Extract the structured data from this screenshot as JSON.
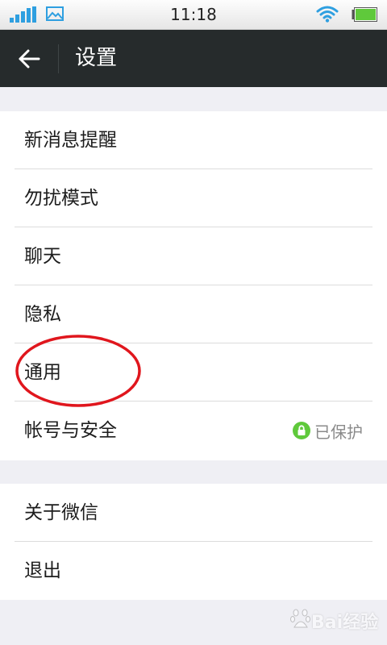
{
  "status_bar": {
    "time": "11:18",
    "signal_icon": "signal-bars-icon",
    "gallery_icon": "gallery-icon",
    "wifi_icon": "wifi-icon",
    "battery_icon": "battery-icon",
    "colors": {
      "signal": "#2e9fe0",
      "wifi": "#2e9fe0",
      "battery": "#5fc93b"
    }
  },
  "app_bar": {
    "title": "设置",
    "back_icon": "back-arrow-icon",
    "background": "#262b2c"
  },
  "settings": {
    "group1": [
      {
        "label": "新消息提醒"
      },
      {
        "label": "勿扰模式"
      },
      {
        "label": "聊天"
      },
      {
        "label": "隐私"
      },
      {
        "label": "通用"
      },
      {
        "label": "帐号与安全",
        "status": "已保护",
        "status_icon": "lock-icon",
        "status_color": "#5fc93b"
      }
    ],
    "group2": [
      {
        "label": "关于微信"
      },
      {
        "label": "退出"
      }
    ]
  },
  "annotation": {
    "highlight": "通用",
    "color": "#e0161d"
  },
  "watermark": {
    "text": "Bai经验"
  }
}
